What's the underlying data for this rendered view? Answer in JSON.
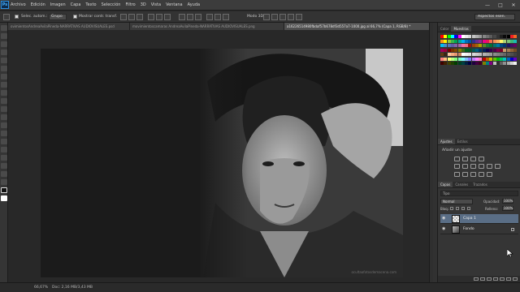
{
  "menubar": {
    "logo": "Ps",
    "items": [
      "Archivo",
      "Edición",
      "Imagen",
      "Capa",
      "Texto",
      "Selección",
      "Filtro",
      "3D",
      "Vista",
      "Ventana",
      "Ayuda"
    ],
    "window_buttons": [
      "—",
      "□",
      "✕"
    ]
  },
  "options": {
    "select_label": "Selec. autom.:",
    "group_value": "Grupo",
    "show_transform": "Mostrar contr. transf.",
    "mode3d": "Modo 3D:",
    "workspace": "Aspectos esen."
  },
  "tabs": [
    {
      "label": "ovimientosAndreaAvilaPineda-NARRATIVAS AUDIOVISUALES.psd",
      "active": false
    },
    {
      "label": "movimientoscamaras AndreaAvilaPineda-NARRATIVAS AUDIOVISUALES.png",
      "active": false
    },
    {
      "label": "a16226514980fbdaf57b678df3d557a7-1000.jpg al 66,7% (Capa 1, RGB/8) *",
      "active": true
    }
  ],
  "canvas": {
    "watermark": "ocultaafotosdemacena.com"
  },
  "status": {
    "zoom": "66,67%",
    "doc": "Doc: 2,16 MB/3,43 MB"
  },
  "swatches": {
    "tabs": [
      "Color",
      "Muestras"
    ],
    "colors": {
      "row1": [
        "#ff0000",
        "#ffff00",
        "#00ff00",
        "#00ffff",
        "#0000ff",
        "#ff00ff",
        "#ffffff",
        "#ebebeb",
        "#d6d6d6",
        "#c2c2c2",
        "#adadad",
        "#999999",
        "#858585",
        "#707070",
        "#5c5c5c",
        "#474747",
        "#333333",
        "#1f1f1f",
        "#0a0a0a",
        "#000000",
        "#ee1d24",
        "#f26522"
      ],
      "row2": [
        "#f7941d",
        "#fff200",
        "#8dc63f",
        "#39b54a",
        "#00a651",
        "#00a99d",
        "#00aeef",
        "#0072bc",
        "#0054a6",
        "#2e3192",
        "#662d91",
        "#92278f",
        "#ec008c",
        "#ed145b",
        "#f26c4f",
        "#f68e56",
        "#fbaf5d",
        "#fff568",
        "#acd373",
        "#7cc576",
        "#3bb878",
        "#1abbb4"
      ],
      "row3": [
        "#00bff3",
        "#448ccb",
        "#5574b9",
        "#605ca8",
        "#8560a8",
        "#a763a8",
        "#f06eaa",
        "#f26d7d",
        "#9e0b0f",
        "#a0410d",
        "#a36209",
        "#aba000",
        "#598527",
        "#197b30",
        "#007236",
        "#00746b",
        "#0076a3",
        "#004a80",
        "#003471",
        "#1b1464",
        "#440e62",
        "#630460"
      ],
      "row4": [
        "#9e005d",
        "#9e0039",
        "#790000",
        "#7b2e00",
        "#7d4900",
        "#827b00",
        "#406618",
        "#005e20",
        "#005826",
        "#005952",
        "#005b7f",
        "#003663",
        "#002157",
        "#0d004c",
        "#32004b",
        "#4b0049",
        "#7b0046",
        "#7a0026",
        "#c69c6d",
        "#a67c52",
        "#8c6239",
        "#754c24"
      ],
      "row5": [
        "#603913",
        "#3c2415",
        "#fbc7a2",
        "#f9ad81",
        "#e89672",
        "#ce8562",
        "#ffffff",
        "#f2f2f2",
        "#e6e6e6",
        "#d9d9d9",
        "#cccccc",
        "#bfbfbf",
        "#b3b3b3",
        "#a6a6a6",
        "#999999",
        "#8c8c8c",
        "#808080",
        "#737373",
        "#666666",
        "#595959",
        "#4d4d4d",
        "#404040"
      ],
      "row6": [
        "#ff8080",
        "#ffbf80",
        "#ffff80",
        "#bfff80",
        "#80ff80",
        "#80ffbf",
        "#80ffff",
        "#80bfff",
        "#8080ff",
        "#bf80ff",
        "#ff80ff",
        "#ff80bf",
        "#c00000",
        "#c06000",
        "#c0c000",
        "#60c000",
        "#00c000",
        "#00c060",
        "#00c0c0",
        "#0060c0",
        "#0000c0",
        "#6000c0"
      ],
      "row7": [
        "#400000",
        "#402000",
        "#404000",
        "#204000",
        "#004000",
        "#004020",
        "#004040",
        "#002040",
        "#000040",
        "#200040",
        "#400040",
        "#400020",
        "#808000",
        "#008080",
        "#800080",
        "#c0c0c0",
        "#303030",
        "#606060",
        "#909090",
        "#b0b0b0",
        "#d0d0d0",
        "#f0f0f0"
      ]
    }
  },
  "adjustments": {
    "tabs": [
      "Ajustes",
      "Estilos"
    ],
    "title": "Añadir un ajuste"
  },
  "layers": {
    "tabs": [
      "Capas",
      "Canales",
      "Trazados"
    ],
    "filter": "Tipo",
    "blend": "Normal",
    "opacity_label": "Opacidad:",
    "opacity_value": "100%",
    "lock_label": "Bloq.:",
    "fill_label": "Relleno:",
    "fill_value": "100%",
    "items": [
      {
        "name": "Capa 1",
        "selected": true
      },
      {
        "name": "Fondo",
        "selected": false
      }
    ]
  }
}
